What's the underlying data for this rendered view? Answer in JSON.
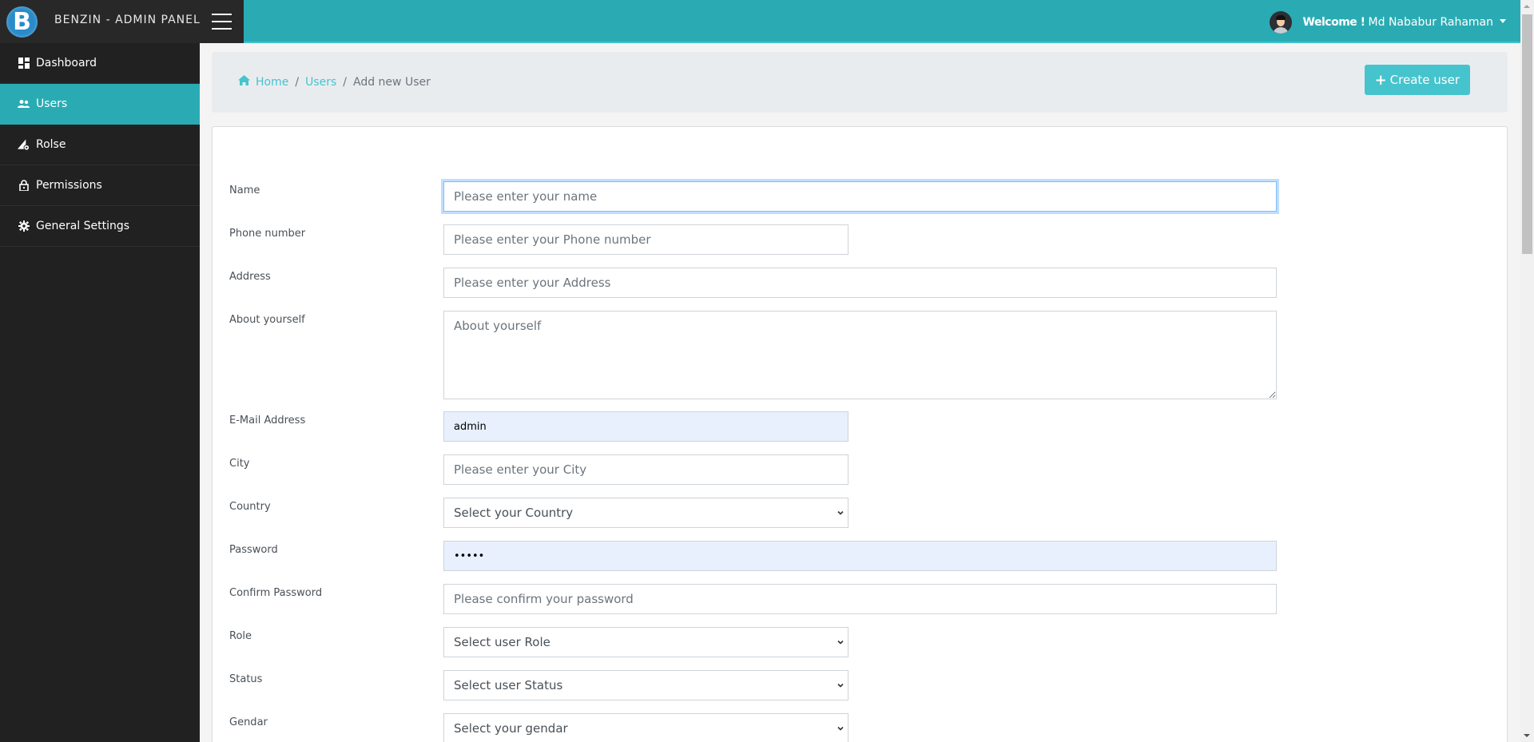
{
  "brand": {
    "logo_letter": "B",
    "title": "BENZIN - ADMIN PANEL"
  },
  "header": {
    "welcome_label": "Welcome !",
    "user_name": "Md Nababur Rahaman"
  },
  "sidebar": {
    "items": [
      {
        "label": "Dashboard",
        "icon": "dashboard-icon",
        "active": false
      },
      {
        "label": "Users",
        "icon": "users-icon",
        "active": true
      },
      {
        "label": "Rolse",
        "icon": "roles-icon",
        "active": false
      },
      {
        "label": "Permissions",
        "icon": "lock-icon",
        "active": false
      },
      {
        "label": "General Settings",
        "icon": "gear-icon",
        "active": false
      }
    ]
  },
  "breadcrumb": {
    "items": [
      {
        "label": "Home",
        "link": true
      },
      {
        "label": "Users",
        "link": true
      },
      {
        "label": "Add new User",
        "link": false
      }
    ],
    "separator": "/"
  },
  "actions": {
    "create_label": "Create user"
  },
  "form": {
    "name": {
      "label": "Name",
      "placeholder": "Please enter your name",
      "value": ""
    },
    "phone": {
      "label": "Phone number",
      "placeholder": "Please enter your Phone number",
      "value": ""
    },
    "address": {
      "label": "Address",
      "placeholder": "Please enter your Address",
      "value": ""
    },
    "about": {
      "label": "About yourself",
      "placeholder": "About yourself",
      "value": ""
    },
    "email": {
      "label": "E-Mail Address",
      "placeholder": "",
      "value": "admin"
    },
    "city": {
      "label": "City",
      "placeholder": "Please enter your City",
      "value": ""
    },
    "country": {
      "label": "Country",
      "selected": "Select your Country"
    },
    "password": {
      "label": "Password",
      "value": "•••••"
    },
    "confirm_password": {
      "label": "Confirm Password",
      "placeholder": "Please confirm your password",
      "value": ""
    },
    "role": {
      "label": "Role",
      "selected": "Select user Role"
    },
    "status": {
      "label": "Status",
      "selected": "Select user Status"
    },
    "gender": {
      "label": "Gendar",
      "selected": "Select your gendar"
    }
  },
  "colors": {
    "accent": "#2aabb3",
    "button": "#45c4cd",
    "sidebar_bg": "#212121",
    "brand_bg": "#282828"
  }
}
